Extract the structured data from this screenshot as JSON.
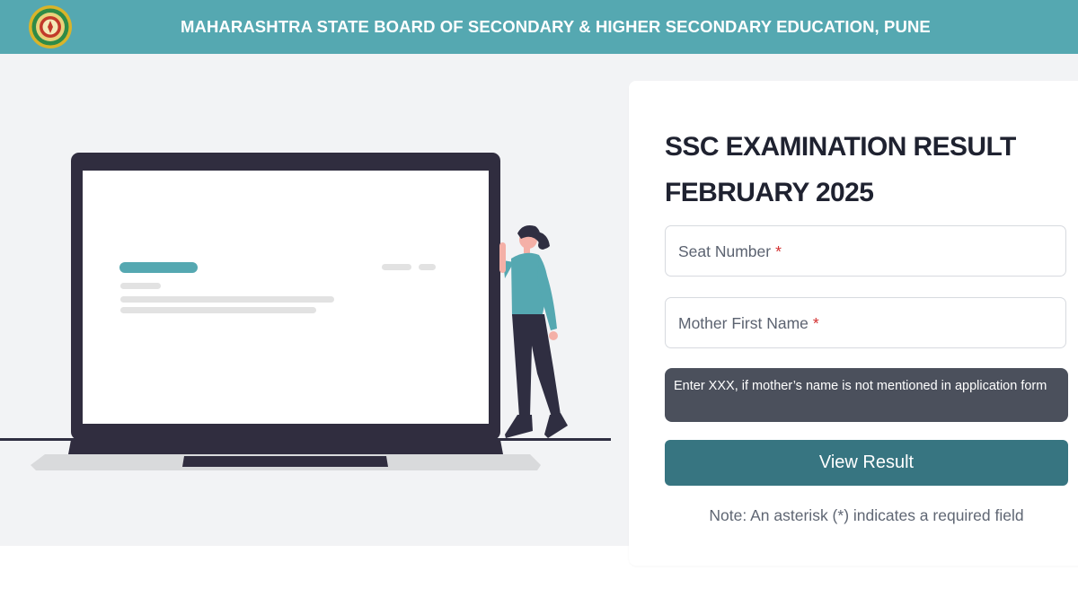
{
  "header": {
    "title": "MAHARASHTRA STATE BOARD OF SECONDARY & HIGHER SECONDARY EDUCATION, PUNE",
    "logo_icon": "board-emblem-icon"
  },
  "form": {
    "title_line1": "SSC EXAMINATION RESULT",
    "title_line2": "FEBRUARY 2025",
    "seat_number_label": "Seat Number",
    "mother_name_label": "Mother First Name",
    "required_marker": "*",
    "hint": "Enter XXX, if mother’s name is not mentioned in application form",
    "submit_label": "View Result",
    "note": "Note: An asterisk (*) indicates a required field"
  },
  "colors": {
    "header_bg": "#55a8b1",
    "button_bg": "#377581",
    "hint_bg": "#4b505c",
    "required": "#d32f2f"
  }
}
